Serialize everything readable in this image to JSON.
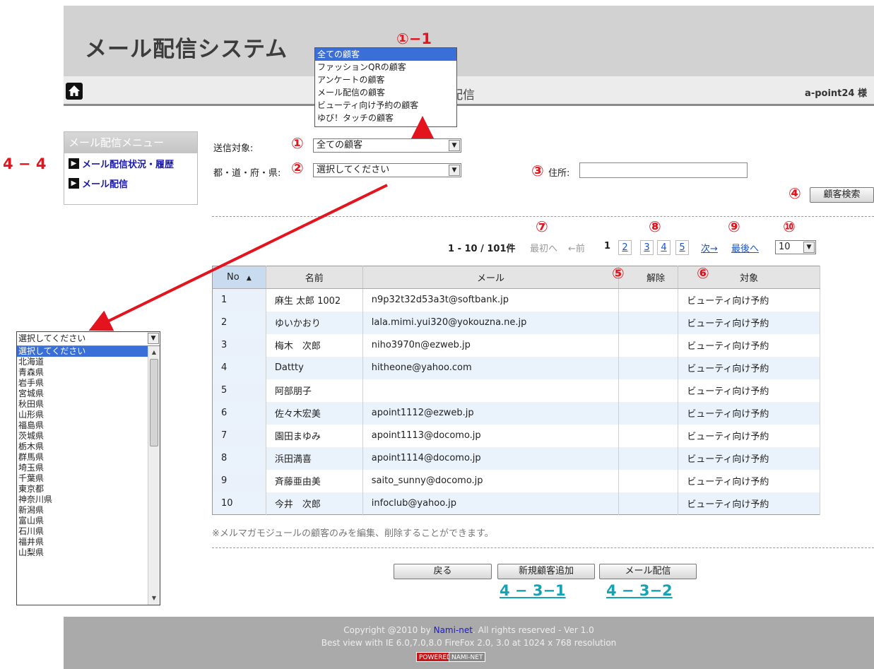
{
  "header": {
    "app_title": "メール配信システム",
    "nav_title": "配信",
    "user": "a-point24 様"
  },
  "sidebar": {
    "title": "メール配信メニュー",
    "items": [
      {
        "label": "メール配信状況・履歴"
      },
      {
        "label": "メール配信"
      }
    ]
  },
  "search": {
    "target_label": "送信対象:",
    "target_value": "全ての顧客",
    "pref_label": "都・道・府・県:",
    "pref_value": "選択してください",
    "address_label": "住所:",
    "address_value": "",
    "search_button": "顧客検索"
  },
  "target_popup": {
    "options": [
      "全ての顧客",
      "ファッションQRの顧客",
      "アンケートの顧客",
      "メール配信の顧客",
      "ビューティ向け予約の顧客",
      "ゆび！タッチの顧客"
    ]
  },
  "pagination": {
    "range": "1 - 10 / 101件",
    "first": "最初へ",
    "prev": "←前",
    "current": "1",
    "pages": [
      "2",
      "3",
      "4",
      "5"
    ],
    "next": "次→",
    "last": "最後へ",
    "page_size": "10"
  },
  "table": {
    "columns": {
      "no": "No",
      "name": "名前",
      "mail": "メール",
      "cancel": "解除",
      "target": "対象"
    },
    "rows": [
      {
        "no": "1",
        "name": "麻生 太郎 1002",
        "mail": "n9p32t32d53a3t@softbank.jp",
        "target": "ビューティ向け予約"
      },
      {
        "no": "2",
        "name": "ゆいかおり",
        "mail": "lala.mimi.yui320@yokouzna.ne.jp",
        "target": "ビューティ向け予約"
      },
      {
        "no": "3",
        "name": "梅木　次郎",
        "mail": "niho3970n@ezweb.jp",
        "target": "ビューティ向け予約"
      },
      {
        "no": "4",
        "name": "Dattty",
        "mail": "hitheone@yahoo.com",
        "target": "ビューティ向け予約"
      },
      {
        "no": "5",
        "name": "阿部朋子",
        "mail": "",
        "target": "ビューティ向け予約"
      },
      {
        "no": "6",
        "name": "佐々木宏美",
        "mail": "apoint1112@ezweb.jp",
        "target": "ビューティ向け予約"
      },
      {
        "no": "7",
        "name": "園田まゆみ",
        "mail": "apoint1113@docomo.jp",
        "target": "ビューティ向け予約"
      },
      {
        "no": "8",
        "name": "浜田満喜",
        "mail": "apoint1114@docomo.jp",
        "target": "ビューティ向け予約"
      },
      {
        "no": "9",
        "name": "斉藤亜由美",
        "mail": "saito_sunny@docomo.jp",
        "target": "ビューティ向け予約"
      },
      {
        "no": "10",
        "name": "今井　次郎",
        "mail": "infoclub@yahoo.jp",
        "target": "ビューティ向け予約"
      }
    ]
  },
  "note": "※メルマガモジュールの顧客のみを編集、削除することができます。",
  "buttons": {
    "back": "戻る",
    "add": "新規顧客追加",
    "send": "メール配信"
  },
  "annotations": {
    "n1": "①",
    "n1_1": "①−1",
    "n2": "②",
    "n3": "③",
    "n4": "④",
    "n5": "⑤",
    "n6": "⑥",
    "n7": "⑦",
    "n8": "⑧",
    "n9": "⑨",
    "n10": "⑩",
    "c44": "4 − 4",
    "c431": "4 − 3−1",
    "c432": "4 − 3−2"
  },
  "prefecture_list": {
    "selected": "選択してください",
    "items": [
      "選択してください",
      "北海道",
      "青森県",
      "岩手県",
      "宮城県",
      "秋田県",
      "山形県",
      "福島県",
      "茨城県",
      "栃木県",
      "群馬県",
      "埼玉県",
      "千葉県",
      "東京都",
      "神奈川県",
      "新潟県",
      "富山県",
      "石川県",
      "福井県",
      "山梨県"
    ]
  },
  "footer": {
    "copy_prefix": "Copyright @2010 by ",
    "brand": "Nami-net",
    "copy_suffix": ". All rights reserved - Ver 1.0",
    "line2": "Best view with IE 6.0,7.0,8.0 FireFox 2.0, 3.0 at 1024 x 768 resolution",
    "badge_powered": "POWERED",
    "badge_name": "NAMI-NET"
  },
  "colors": {
    "annotation_red": "#e4141e",
    "annotation_teal": "#14a3b4",
    "link": "#1a55c9",
    "selected": "#3b6fd8"
  }
}
